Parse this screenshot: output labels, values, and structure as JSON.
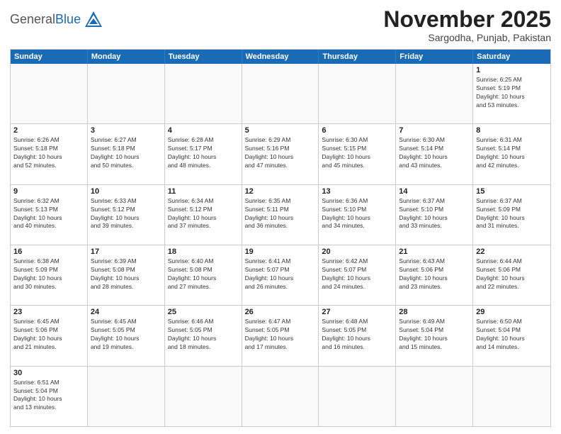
{
  "header": {
    "logo_general": "General",
    "logo_blue": "Blue",
    "month_title": "November 2025",
    "subtitle": "Sargodha, Punjab, Pakistan"
  },
  "weekdays": [
    "Sunday",
    "Monday",
    "Tuesday",
    "Wednesday",
    "Thursday",
    "Friday",
    "Saturday"
  ],
  "rows": [
    [
      {
        "day": "",
        "info": ""
      },
      {
        "day": "",
        "info": ""
      },
      {
        "day": "",
        "info": ""
      },
      {
        "day": "",
        "info": ""
      },
      {
        "day": "",
        "info": ""
      },
      {
        "day": "",
        "info": ""
      },
      {
        "day": "1",
        "info": "Sunrise: 6:25 AM\nSunset: 5:19 PM\nDaylight: 10 hours\nand 53 minutes."
      }
    ],
    [
      {
        "day": "2",
        "info": "Sunrise: 6:26 AM\nSunset: 5:18 PM\nDaylight: 10 hours\nand 52 minutes."
      },
      {
        "day": "3",
        "info": "Sunrise: 6:27 AM\nSunset: 5:18 PM\nDaylight: 10 hours\nand 50 minutes."
      },
      {
        "day": "4",
        "info": "Sunrise: 6:28 AM\nSunset: 5:17 PM\nDaylight: 10 hours\nand 48 minutes."
      },
      {
        "day": "5",
        "info": "Sunrise: 6:29 AM\nSunset: 5:16 PM\nDaylight: 10 hours\nand 47 minutes."
      },
      {
        "day": "6",
        "info": "Sunrise: 6:30 AM\nSunset: 5:15 PM\nDaylight: 10 hours\nand 45 minutes."
      },
      {
        "day": "7",
        "info": "Sunrise: 6:30 AM\nSunset: 5:14 PM\nDaylight: 10 hours\nand 43 minutes."
      },
      {
        "day": "8",
        "info": "Sunrise: 6:31 AM\nSunset: 5:14 PM\nDaylight: 10 hours\nand 42 minutes."
      }
    ],
    [
      {
        "day": "9",
        "info": "Sunrise: 6:32 AM\nSunset: 5:13 PM\nDaylight: 10 hours\nand 40 minutes."
      },
      {
        "day": "10",
        "info": "Sunrise: 6:33 AM\nSunset: 5:12 PM\nDaylight: 10 hours\nand 39 minutes."
      },
      {
        "day": "11",
        "info": "Sunrise: 6:34 AM\nSunset: 5:12 PM\nDaylight: 10 hours\nand 37 minutes."
      },
      {
        "day": "12",
        "info": "Sunrise: 6:35 AM\nSunset: 5:11 PM\nDaylight: 10 hours\nand 36 minutes."
      },
      {
        "day": "13",
        "info": "Sunrise: 6:36 AM\nSunset: 5:10 PM\nDaylight: 10 hours\nand 34 minutes."
      },
      {
        "day": "14",
        "info": "Sunrise: 6:37 AM\nSunset: 5:10 PM\nDaylight: 10 hours\nand 33 minutes."
      },
      {
        "day": "15",
        "info": "Sunrise: 6:37 AM\nSunset: 5:09 PM\nDaylight: 10 hours\nand 31 minutes."
      }
    ],
    [
      {
        "day": "16",
        "info": "Sunrise: 6:38 AM\nSunset: 5:09 PM\nDaylight: 10 hours\nand 30 minutes."
      },
      {
        "day": "17",
        "info": "Sunrise: 6:39 AM\nSunset: 5:08 PM\nDaylight: 10 hours\nand 28 minutes."
      },
      {
        "day": "18",
        "info": "Sunrise: 6:40 AM\nSunset: 5:08 PM\nDaylight: 10 hours\nand 27 minutes."
      },
      {
        "day": "19",
        "info": "Sunrise: 6:41 AM\nSunset: 5:07 PM\nDaylight: 10 hours\nand 26 minutes."
      },
      {
        "day": "20",
        "info": "Sunrise: 6:42 AM\nSunset: 5:07 PM\nDaylight: 10 hours\nand 24 minutes."
      },
      {
        "day": "21",
        "info": "Sunrise: 6:43 AM\nSunset: 5:06 PM\nDaylight: 10 hours\nand 23 minutes."
      },
      {
        "day": "22",
        "info": "Sunrise: 6:44 AM\nSunset: 5:06 PM\nDaylight: 10 hours\nand 22 minutes."
      }
    ],
    [
      {
        "day": "23",
        "info": "Sunrise: 6:45 AM\nSunset: 5:06 PM\nDaylight: 10 hours\nand 21 minutes."
      },
      {
        "day": "24",
        "info": "Sunrise: 6:45 AM\nSunset: 5:05 PM\nDaylight: 10 hours\nand 19 minutes."
      },
      {
        "day": "25",
        "info": "Sunrise: 6:46 AM\nSunset: 5:05 PM\nDaylight: 10 hours\nand 18 minutes."
      },
      {
        "day": "26",
        "info": "Sunrise: 6:47 AM\nSunset: 5:05 PM\nDaylight: 10 hours\nand 17 minutes."
      },
      {
        "day": "27",
        "info": "Sunrise: 6:48 AM\nSunset: 5:05 PM\nDaylight: 10 hours\nand 16 minutes."
      },
      {
        "day": "28",
        "info": "Sunrise: 6:49 AM\nSunset: 5:04 PM\nDaylight: 10 hours\nand 15 minutes."
      },
      {
        "day": "29",
        "info": "Sunrise: 6:50 AM\nSunset: 5:04 PM\nDaylight: 10 hours\nand 14 minutes."
      }
    ],
    [
      {
        "day": "30",
        "info": "Sunrise: 6:51 AM\nSunset: 5:04 PM\nDaylight: 10 hours\nand 13 minutes."
      },
      {
        "day": "",
        "info": ""
      },
      {
        "day": "",
        "info": ""
      },
      {
        "day": "",
        "info": ""
      },
      {
        "day": "",
        "info": ""
      },
      {
        "day": "",
        "info": ""
      },
      {
        "day": "",
        "info": ""
      }
    ]
  ]
}
